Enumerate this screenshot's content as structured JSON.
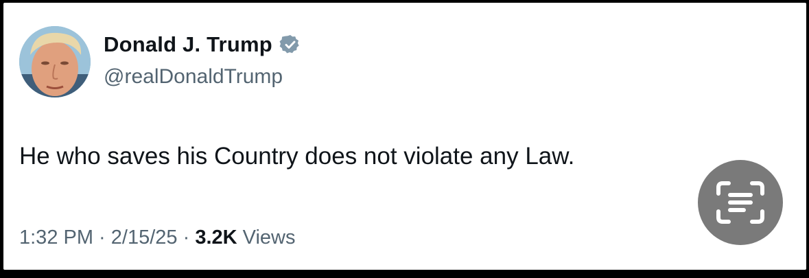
{
  "tweet": {
    "author": {
      "display_name": "Donald J. Trump",
      "handle": "@realDonaldTrump",
      "verified_icon": "verified-badge-icon",
      "avatar": "profile-photo"
    },
    "text": "He who saves his Country does not violate any Law.",
    "meta": {
      "time": "1:32 PM",
      "separator": " · ",
      "date": "2/15/25",
      "views_count": "3.2K",
      "views_label": "Views"
    }
  },
  "overlay": {
    "scan_button_icon": "live-text-scan-icon"
  },
  "colors": {
    "background": "#000000",
    "card": "#ffffff",
    "primary_text": "#0f1419",
    "secondary_text": "#536471",
    "verified_badge": "#829aab",
    "scan_button": "#7a7a7a"
  }
}
